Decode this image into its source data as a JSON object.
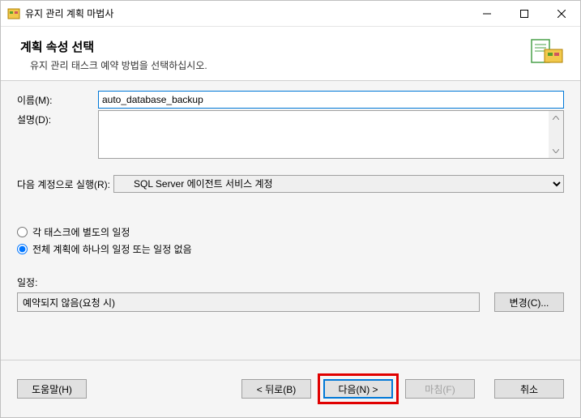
{
  "titlebar": {
    "title": "유지 관리 계획 마법사"
  },
  "header": {
    "title": "계획 속성 선택",
    "subtitle": "유지 관리 태스크 예약 방법을 선택하십시오."
  },
  "form": {
    "name_label": "이름(M):",
    "name_value": "auto_database_backup",
    "desc_label": "설명(D):",
    "desc_value": ""
  },
  "runas": {
    "label": "다음 계정으로 실행(R):",
    "selected": "SQL Server 에이전트 서비스 계정"
  },
  "schedule_mode": {
    "per_task_label": "각 태스크에 별도의 일정",
    "single_label": "전체 계획에 하나의 일정 또는 일정 없음",
    "selected": "single"
  },
  "schedule": {
    "label": "일정:",
    "value": "예약되지 않음(요청 시)",
    "change_button": "변경(C)..."
  },
  "footer": {
    "help": "도움말(H)",
    "back": "< 뒤로(B)",
    "next": "다음(N) >",
    "finish": "마침(F)",
    "cancel": "취소"
  }
}
